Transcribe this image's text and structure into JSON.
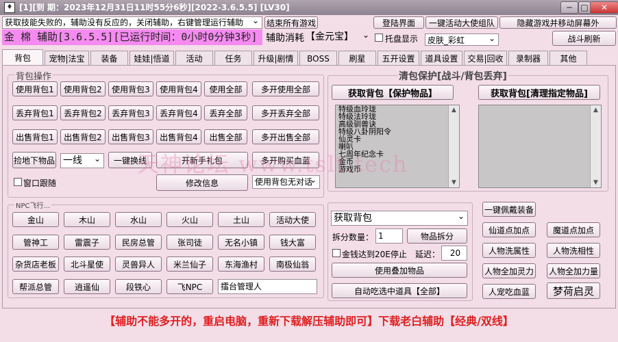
{
  "titlebar": {
    "title": "[1][到 期：2023年12月31日11时55分6秒][2022-3.6.5.5] [LV30]",
    "min": "─",
    "restore": "□",
    "close": "✕"
  },
  "top": {
    "hint_select": "获取技能失败的，辅助没有反应的，关闭辅助，右键管理运行辅助",
    "end_all_games": "结束所有游戏",
    "login_screen": "登陆界面",
    "one_key_team": "一键活动大使组队",
    "hide_game": "隐藏游戏并移动屏幕外",
    "status": "金 棉 辅助[3.6.5.5][已运行时间：0小时0分钟3秒]",
    "consume_label": "辅助消耗",
    "consume_select": "【金元宝】",
    "tray_label": "托盘显示",
    "skin_select": "皮肤_彩虹",
    "battle_refresh": "战斗刷新"
  },
  "tabs": [
    "背包",
    "宠物|法宝",
    "装备",
    "娃娃|悟道",
    "活动",
    "任务",
    "升级|剧情",
    "BOSS",
    "刷星",
    "五开设置",
    "道具设置",
    "交易|回收",
    "录制器",
    "其他"
  ],
  "bag_ops": {
    "title": "背包操作",
    "use_row": [
      "使用背包1",
      "使用背包2",
      "使用背包3",
      "使用背包4",
      "使用全部",
      "多开使用全部"
    ],
    "drop_row": [
      "丢弃背包1",
      "丢弃背包2",
      "丢弃背包3",
      "丢弃背包4",
      "丢弃全部",
      "多开丢弃全部"
    ],
    "sell_row": [
      "出售背包1",
      "出售背包2",
      "出售背包3",
      "出售背包4",
      "出售全部",
      "多开出售全部"
    ],
    "pickup": "捡地下物品",
    "line_select": "一线",
    "switch_line": "一键换线",
    "open_gift": "开新手礼包",
    "buy_blood": "多开购买血蓝",
    "follow_label": "窗口跟随",
    "modify_info": "修改信息",
    "bag_invalid_select": "使用背包无对话"
  },
  "npc": {
    "title": "NPC飞行...",
    "rows": [
      [
        "金山",
        "木山",
        "水山",
        "火山",
        "土山",
        "活动大使"
      ],
      [
        "管神工",
        "雷震子",
        "民房总管",
        "张司徒",
        "无名小镇",
        "钱大富"
      ],
      [
        "杂货店老板",
        "北斗星使",
        "灵兽异人",
        "米兰仙子",
        "东海渔村",
        "南极仙翁"
      ],
      [
        "帮派总管",
        "逍遥仙",
        "段铁心",
        "飞NPC"
      ]
    ],
    "input_value": "擂台管理人"
  },
  "protect": {
    "title": "清包保护[战斗/背包丢弃]",
    "get_protect": "获取背包【保护物品】",
    "get_clean": "获取背包[清理指定物品]",
    "protect_items": [
      "特级血玲珑",
      "特级法玲珑",
      "高级驯兽诀",
      "特级八卦阴阳令",
      "仙灵卡",
      "喇叭",
      "七周年纪念卡",
      "金币",
      "游戏币"
    ]
  },
  "split": {
    "get_bag_select": "获取背包",
    "split_qty_label": "拆分数量：",
    "split_qty_value": "1",
    "split_button": "物品拆分",
    "stop_label": "金钱达到20E停止",
    "delay_label": "延迟：",
    "delay_value": "20",
    "use_stack": "使用叠加物品",
    "auto_eat": "自动吃选中道具【全部】"
  },
  "right_actions": {
    "equip": "一键佩戴装备",
    "xian_points": "仙道点加点",
    "mo_points": "魔道点加点",
    "wash_attr": "人物洗属性",
    "wash_xiang": "人物洗相性",
    "add_spirit": "人物全加灵力",
    "add_power": "人物全加力量",
    "pet_blood": "人宠吃血蓝",
    "dream_start": "梦荷启灵"
  },
  "watermark": "天神论坛 www.tslt.tech",
  "footer": "【辅助不能多开的，重启电脑，重新下载解压辅助即可】下载老白辅助【经典/双线】",
  "colors": {
    "banner": "#f58bf0",
    "background": "#f3dde7",
    "footer_text": "#e02020"
  }
}
